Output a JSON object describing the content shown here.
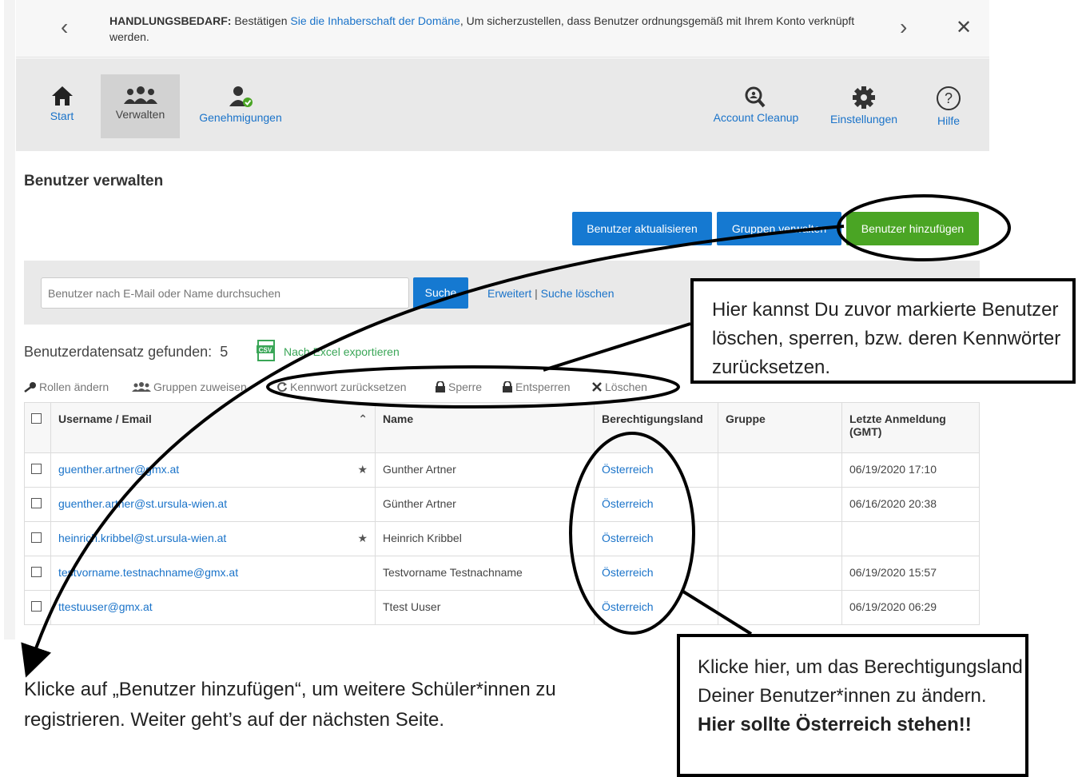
{
  "notice": {
    "label": "HANDLUNGSBEDARF:",
    "text_before": " Bestätigen ",
    "link": "Sie die Inhaberschaft der Domäne",
    "text_after": ", Um sicherzustellen, dass Benutzer ordnungsgemäß mit Ihrem Konto verknüpft werden.",
    "prev_icon": "chevron-left-icon",
    "next_icon": "chevron-right-icon",
    "close_icon": "close-icon"
  },
  "toolbar": {
    "start": "Start",
    "verwalten": "Verwalten",
    "genehmigungen": "Genehmigungen",
    "cleanup": "Account Cleanup",
    "einstellungen": "Einstellungen",
    "hilfe": "Hilfe"
  },
  "page_title": "Benutzer verwalten",
  "buttons": {
    "aktualisieren": "Benutzer aktualisieren",
    "gruppen": "Gruppen verwalten",
    "hinzufuegen": "Benutzer hinzufügen"
  },
  "search": {
    "placeholder": "Benutzer nach E-Mail oder Name durchsuchen",
    "button": "Suche",
    "advanced": "Erweitert",
    "separator": " | ",
    "clear": "Suche löschen"
  },
  "results": {
    "label": "Benutzerdatensatz gefunden:",
    "count": "5",
    "export": "Nach Excel exportieren"
  },
  "actions": {
    "rollen": "Rollen ändern",
    "gruppen_zuweisen": "Gruppen zuweisen",
    "kennwort": "Kennwort zurücksetzen",
    "sperre": "Sperre",
    "entsperren": "Entsperren",
    "loeschen": "Löschen"
  },
  "table": {
    "headers": {
      "username": "Username / Email",
      "name": "Name",
      "land": "Berechtigungsland",
      "gruppe": "Gruppe",
      "anmeldung": "Letzte Anmeldung (GMT)"
    },
    "rows": [
      {
        "email": "guenther.artner@gmx.at",
        "starred": true,
        "name": "Gunther Artner",
        "land": "Österreich",
        "gruppe": "",
        "anmeldung": "06/19/2020 17:10"
      },
      {
        "email": "guenther.artner@st.ursula-wien.at",
        "starred": false,
        "name": "Günther Artner",
        "land": "Österreich",
        "gruppe": "",
        "anmeldung": "06/16/2020 20:38"
      },
      {
        "email": "heinrich.kribbel@st.ursula-wien.at",
        "starred": true,
        "name": "Heinrich Kribbel",
        "land": "Österreich",
        "gruppe": "",
        "anmeldung": ""
      },
      {
        "email": "testvorname.testnachname@gmx.at",
        "starred": false,
        "name": "Testvorname Testnachname",
        "land": "Österreich",
        "gruppe": "",
        "anmeldung": "06/19/2020 15:57"
      },
      {
        "email": "ttestuuser@gmx.at",
        "starred": false,
        "name": "Ttest Uuser",
        "land": "Österreich",
        "gruppe": "",
        "anmeldung": "06/19/2020 06:29"
      }
    ]
  },
  "annotations": {
    "callout_top": "Hier kannst Du zuvor markierte Benutzer löschen, sperren, bzw. deren Kennwörter zurücksetzen.",
    "callout_bottom": "Klicke hier, um das Berechtigungsland Deiner Benutzer*innen zu ändern.",
    "callout_bottom_bold": "Hier sollte Österreich stehen!!",
    "bottom_note": "Klicke auf „Benutzer hinzufügen“, um weitere Schüler*innen zu registrieren. Weiter geht’s auf der nächsten Seite."
  }
}
